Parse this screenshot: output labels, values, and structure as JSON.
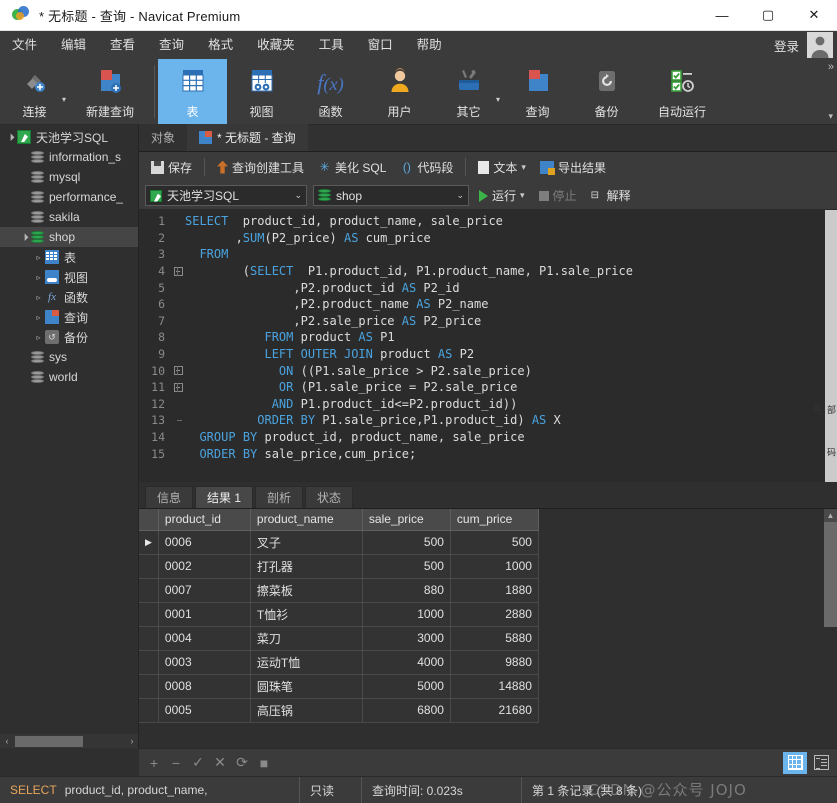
{
  "window": {
    "title": "* 无标题 - 查询 - Navicat Premium",
    "logo_icon": "navicat-logo-icon",
    "minimize_label": "—",
    "maximize_label": "▢",
    "close_label": "✕"
  },
  "menubar": {
    "items": [
      {
        "label": "文件",
        "name": "menu-file"
      },
      {
        "label": "编辑",
        "name": "menu-edit"
      },
      {
        "label": "查看",
        "name": "menu-view"
      },
      {
        "label": "查询",
        "name": "menu-query"
      },
      {
        "label": "格式",
        "name": "menu-format"
      },
      {
        "label": "收藏夹",
        "name": "menu-favorites"
      },
      {
        "label": "工具",
        "name": "menu-tools"
      },
      {
        "label": "窗口",
        "name": "menu-window"
      },
      {
        "label": "帮助",
        "name": "menu-help"
      }
    ],
    "login_label": "登录",
    "avatar_icon": "user-avatar-icon"
  },
  "ribbon": {
    "overflow_label": "»",
    "more_label": "▾",
    "items": [
      {
        "label": "连接",
        "icon": "connection-icon",
        "has_caret": true,
        "active": false
      },
      {
        "label": "新建查询",
        "icon": "new-query-icon",
        "has_caret": false,
        "active": false
      },
      {
        "label": "表",
        "icon": "table-icon",
        "has_caret": false,
        "active": true
      },
      {
        "label": "视图",
        "icon": "view-icon",
        "has_caret": false,
        "active": false
      },
      {
        "label": "函数",
        "icon": "function-icon",
        "has_caret": false,
        "active": false
      },
      {
        "label": "用户",
        "icon": "user-icon",
        "has_caret": false,
        "active": false
      },
      {
        "label": "其它",
        "icon": "other-tools-icon",
        "has_caret": true,
        "active": false
      },
      {
        "label": "查询",
        "icon": "query-icon",
        "has_caret": false,
        "active": false
      },
      {
        "label": "备份",
        "icon": "backup-icon",
        "has_caret": false,
        "active": false
      },
      {
        "label": "自动运行",
        "icon": "automation-icon",
        "has_caret": false,
        "active": false
      }
    ]
  },
  "sidebar": {
    "tree": [
      {
        "label": "天池学习SQL",
        "indent": 0,
        "icon": "connection-icon",
        "twisty": "▾",
        "selected": false
      },
      {
        "label": "information_s",
        "indent": 1,
        "icon": "database-icon",
        "twisty": "",
        "selected": false
      },
      {
        "label": "mysql",
        "indent": 1,
        "icon": "database-icon",
        "twisty": "",
        "selected": false
      },
      {
        "label": "performance_",
        "indent": 1,
        "icon": "database-icon",
        "twisty": "",
        "selected": false
      },
      {
        "label": "sakila",
        "indent": 1,
        "icon": "database-icon",
        "twisty": "",
        "selected": false
      },
      {
        "label": "shop",
        "indent": 1,
        "icon": "database-open-icon",
        "twisty": "▾",
        "selected": true
      },
      {
        "label": "表",
        "indent": 2,
        "icon": "tables-folder-icon",
        "twisty": "▸",
        "selected": false
      },
      {
        "label": "视图",
        "indent": 2,
        "icon": "views-folder-icon",
        "twisty": "▸",
        "selected": false
      },
      {
        "label": "函数",
        "indent": 2,
        "icon": "functions-folder-icon",
        "twisty": "▸",
        "selected": false
      },
      {
        "label": "查询",
        "indent": 2,
        "icon": "queries-folder-icon",
        "twisty": "▸",
        "selected": false
      },
      {
        "label": "备份",
        "indent": 2,
        "icon": "backups-folder-icon",
        "twisty": "▸",
        "selected": false
      },
      {
        "label": "sys",
        "indent": 1,
        "icon": "database-icon",
        "twisty": "",
        "selected": false
      },
      {
        "label": "world",
        "indent": 1,
        "icon": "database-icon",
        "twisty": "",
        "selected": false
      }
    ],
    "scroll_left_icon": "chevron-left-icon",
    "scroll_right_icon": "chevron-right-icon"
  },
  "main": {
    "tabs": [
      {
        "label": "对象",
        "icon": "",
        "active": false
      },
      {
        "label": "* 无标题 - 查询",
        "icon": "query-tab-icon",
        "active": true
      }
    ],
    "query_toolbar": [
      {
        "label": "保存",
        "icon": "save-icon"
      },
      {
        "label": "查询创建工具",
        "icon": "query-builder-icon"
      },
      {
        "label": "美化 SQL",
        "icon": "beautify-sql-icon"
      },
      {
        "label": "代码段",
        "icon": "code-snippet-icon"
      },
      {
        "label": "文本",
        "icon": "text-icon"
      },
      {
        "label": "导出结果",
        "icon": "export-result-icon"
      }
    ],
    "connection_combo": {
      "value": "天池学习SQL",
      "icon": "connection-icon",
      "chevron": "⌄"
    },
    "database_combo": {
      "value": "shop",
      "icon": "database-open-icon",
      "chevron": "⌄"
    },
    "run_label": "运行",
    "run_caret": "▾",
    "stop_label": "停止",
    "explain_label": "解释"
  },
  "editor": {
    "lines": [
      {
        "n": 1,
        "fold": "",
        "text": "SELECT  product_id, product_name, sale_price"
      },
      {
        "n": 2,
        "fold": "",
        "text": "       ,SUM(P2_price) AS cum_price"
      },
      {
        "n": 3,
        "fold": "",
        "text": "  FROM"
      },
      {
        "n": 4,
        "fold": "minus",
        "text": "        (SELECT  P1.product_id, P1.product_name, P1.sale_price"
      },
      {
        "n": 5,
        "fold": "bar",
        "text": "               ,P2.product_id AS P2_id"
      },
      {
        "n": 6,
        "fold": "bar",
        "text": "               ,P2.product_name AS P2_name"
      },
      {
        "n": 7,
        "fold": "bar",
        "text": "               ,P2.sale_price AS P2_price"
      },
      {
        "n": 8,
        "fold": "bar",
        "text": "           FROM product AS P1"
      },
      {
        "n": 9,
        "fold": "bar",
        "text": "           LEFT OUTER JOIN product AS P2"
      },
      {
        "n": 10,
        "fold": "minus",
        "text": "             ON ((P1.sale_price > P2.sale_price)"
      },
      {
        "n": 11,
        "fold": "minus",
        "text": "             OR (P1.sale_price = P2.sale_price"
      },
      {
        "n": 12,
        "fold": "bar",
        "text": "            AND P1.product_id<=P2.product_id))"
      },
      {
        "n": 13,
        "fold": "end",
        "text": "          ORDER BY P1.sale_price,P1.product_id) AS X"
      },
      {
        "n": 14,
        "fold": "",
        "text": "  GROUP BY product_id, product_name, sale_price"
      },
      {
        "n": 15,
        "fold": "",
        "text": "  ORDER BY sale_price,cum_price;"
      }
    ],
    "side_strip_text": "部 码 号"
  },
  "results": {
    "tabs": [
      {
        "label": "信息",
        "active": false
      },
      {
        "label": "结果 1",
        "active": true
      },
      {
        "label": "剖析",
        "active": false
      },
      {
        "label": "状态",
        "active": false
      }
    ],
    "columns": [
      "product_id",
      "product_name",
      "sale_price",
      "cum_price"
    ],
    "rows": [
      {
        "current": true,
        "cells": [
          "0006",
          "叉子",
          "500",
          "500"
        ]
      },
      {
        "current": false,
        "cells": [
          "0002",
          "打孔器",
          "500",
          "1000"
        ]
      },
      {
        "current": false,
        "cells": [
          "0007",
          "擦菜板",
          "880",
          "1880"
        ]
      },
      {
        "current": false,
        "cells": [
          "0001",
          "T恤衫",
          "1000",
          "2880"
        ]
      },
      {
        "current": false,
        "cells": [
          "0004",
          "菜刀",
          "3000",
          "5880"
        ]
      },
      {
        "current": false,
        "cells": [
          "0003",
          "运动T恤",
          "4000",
          "9880"
        ]
      },
      {
        "current": false,
        "cells": [
          "0008",
          "圆珠笔",
          "5000",
          "14880"
        ]
      },
      {
        "current": false,
        "cells": [
          "0005",
          "高压锅",
          "6800",
          "21680"
        ]
      }
    ],
    "row_marker_icon": "current-row-marker-icon",
    "scroll_up_icon": "chevron-up-icon"
  },
  "grid_tools": {
    "buttons": [
      {
        "icon": "add-record-icon",
        "label": "+"
      },
      {
        "icon": "remove-record-icon",
        "label": "−"
      },
      {
        "icon": "apply-change-icon",
        "label": "✓"
      },
      {
        "icon": "cancel-change-icon",
        "label": "✕"
      },
      {
        "icon": "refresh-icon",
        "label": "⟳"
      },
      {
        "icon": "stop-icon",
        "label": "■"
      }
    ],
    "grid_view_icon": "grid-view-icon",
    "form_view_icon": "form-view-icon"
  },
  "statusbar": {
    "sql_prefix": "SELECT",
    "sql_text": "product_id, product_name,",
    "readonly": "只读",
    "query_time": "查询时间: 0.023s",
    "record_info": "第 1 条记录 (共 8 条)",
    "watermark": "CSDN @公众号 JOJO"
  }
}
